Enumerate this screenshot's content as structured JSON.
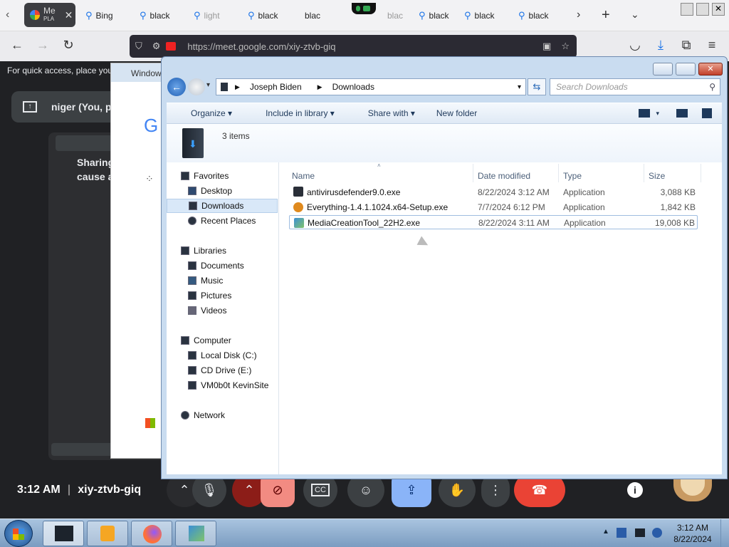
{
  "browser": {
    "active_tab": {
      "label": "Me",
      "sublabel": "PLA"
    },
    "tabs": [
      "Bing",
      "black",
      "light",
      "black",
      "blac",
      "blac",
      "black",
      "black",
      "black"
    ],
    "url": "https://meet.google.com/xiy-ztvb-giq",
    "bookmarks_hint": "For quick access, place you"
  },
  "meet": {
    "participant_pill": "niger (You, p",
    "share_line1": "Sharing",
    "share_line2": "cause a",
    "back_window_title": "Window",
    "clock": "3:12 AM",
    "meeting_code": "xiy-ztvb-giq",
    "cc_label": "CC"
  },
  "explorer": {
    "breadcrumb": [
      "Joseph Biden",
      "Downloads"
    ],
    "search_placeholder": "Search Downloads",
    "toolbar": {
      "organize": "Organize",
      "include": "Include in library",
      "share": "Share with",
      "new_folder": "New folder"
    },
    "items_count": "3 items",
    "nav": {
      "favorites": "Favorites",
      "desktop": "Desktop",
      "downloads": "Downloads",
      "recent": "Recent Places",
      "libraries": "Libraries",
      "documents": "Documents",
      "music": "Music",
      "pictures": "Pictures",
      "videos": "Videos",
      "computer": "Computer",
      "local_disk": "Local Disk (C:)",
      "cd_drive": "CD Drive (E:)",
      "vm": "VM0b0t KevinSite",
      "network": "Network"
    },
    "columns": {
      "name": "Name",
      "date": "Date modified",
      "type": "Type",
      "size": "Size"
    },
    "files": [
      {
        "name": "antivirusdefender9.0.exe",
        "date": "8/22/2024 3:12 AM",
        "type": "Application",
        "size": "3,088 KB"
      },
      {
        "name": "Everything-1.4.1.1024.x64-Setup.exe",
        "date": "7/7/2024 6:12 PM",
        "type": "Application",
        "size": "1,842 KB"
      },
      {
        "name": "MediaCreationTool_22H2.exe",
        "date": "8/22/2024 3:11 AM",
        "type": "Application",
        "size": "19,008 KB"
      }
    ]
  },
  "taskbar": {
    "time": "3:12 AM",
    "date": "8/22/2024"
  },
  "colors": {
    "accent": "#1a73e8",
    "end_call": "#ea4335",
    "present_active": "#8ab4f8",
    "cam_off": "#f28b82"
  }
}
